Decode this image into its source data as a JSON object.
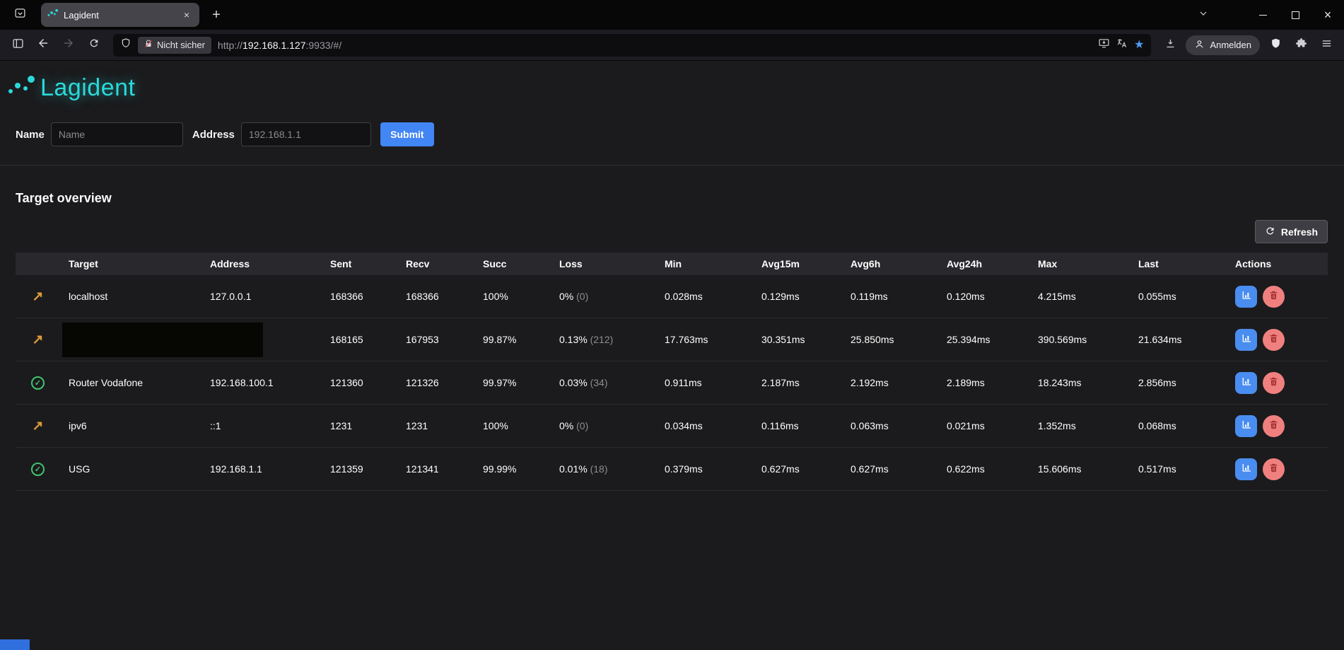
{
  "colors": {
    "accent_cyan": "#2bd9d9",
    "submit_blue": "#4285f4",
    "chart_blue": "#4a8df0",
    "delete_pink": "#f0807f",
    "status_ok": "#41c36f",
    "status_warn": "#e09c3c",
    "bookmark_star": "#4d9ef7"
  },
  "icons": {
    "warn_arrow": "↗",
    "ok_check": "✓",
    "new_tab": "+",
    "tab_close": "×",
    "window_close": "×"
  },
  "browser": {
    "tab_title": "Lagident",
    "security_label": "Nicht sicher",
    "url_scheme": "http://",
    "url_host": "192.168.1.127",
    "url_rest": ":9933/#/",
    "signin_label": "Anmelden"
  },
  "app": {
    "logo": "Lagident",
    "form": {
      "name_label": "Name",
      "name_placeholder": "Name",
      "address_label": "Address",
      "address_placeholder": "192.168.1.1",
      "submit_label": "Submit"
    },
    "overview": {
      "title": "Target overview",
      "refresh_label": "Refresh"
    },
    "table": {
      "headers": [
        "",
        "Target",
        "Address",
        "Sent",
        "Recv",
        "Succ",
        "Loss",
        "Min",
        "Avg15m",
        "Avg6h",
        "Avg24h",
        "Max",
        "Last",
        "Actions"
      ],
      "rows": [
        {
          "status": "warn",
          "target": "localhost",
          "address": "127.0.0.1",
          "sent": "168366",
          "recv": "168366",
          "succ": "100%",
          "loss": "0%",
          "loss_count": "(0)",
          "min": "0.028ms",
          "avg15m": "0.129ms",
          "avg6h": "0.119ms",
          "avg24h": "0.120ms",
          "max": "4.215ms",
          "last": "0.055ms"
        },
        {
          "status": "warn",
          "redacted": true,
          "target": "",
          "address": "",
          "sent": "168165",
          "recv": "167953",
          "succ": "99.87%",
          "loss": "0.13%",
          "loss_count": "(212)",
          "min": "17.763ms",
          "avg15m": "30.351ms",
          "avg6h": "25.850ms",
          "avg24h": "25.394ms",
          "max": "390.569ms",
          "last": "21.634ms"
        },
        {
          "status": "ok",
          "target": "Router Vodafone",
          "address": "192.168.100.1",
          "sent": "121360",
          "recv": "121326",
          "succ": "99.97%",
          "loss": "0.03%",
          "loss_count": "(34)",
          "min": "0.911ms",
          "avg15m": "2.187ms",
          "avg6h": "2.192ms",
          "avg24h": "2.189ms",
          "max": "18.243ms",
          "last": "2.856ms"
        },
        {
          "status": "warn",
          "target": "ipv6",
          "address": "::1",
          "sent": "1231",
          "recv": "1231",
          "succ": "100%",
          "loss": "0%",
          "loss_count": "(0)",
          "min": "0.034ms",
          "avg15m": "0.116ms",
          "avg6h": "0.063ms",
          "avg24h": "0.021ms",
          "max": "1.352ms",
          "last": "0.068ms"
        },
        {
          "status": "ok",
          "target": "USG",
          "address": "192.168.1.1",
          "sent": "121359",
          "recv": "121341",
          "succ": "99.99%",
          "loss": "0.01%",
          "loss_count": "(18)",
          "min": "0.379ms",
          "avg15m": "0.627ms",
          "avg6h": "0.627ms",
          "avg24h": "0.622ms",
          "max": "15.606ms",
          "last": "0.517ms"
        }
      ]
    }
  }
}
